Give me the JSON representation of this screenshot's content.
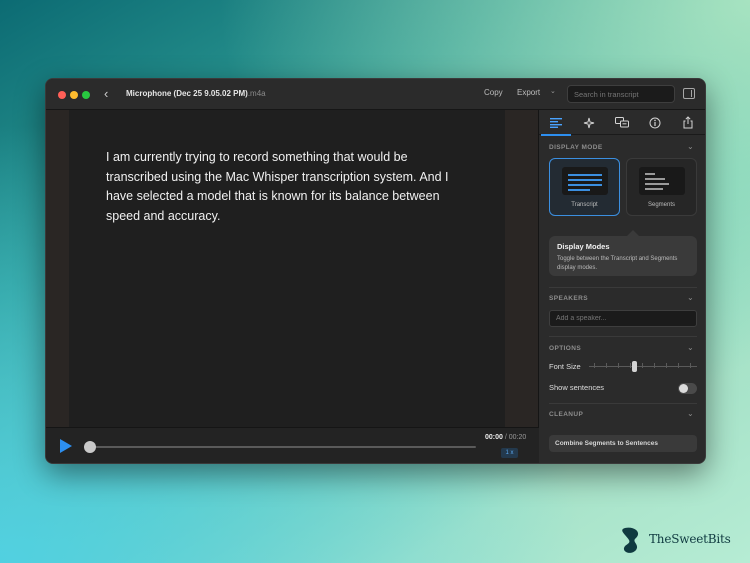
{
  "window": {
    "title": "Microphone (Dec 25 9.05.02 PM)",
    "title_ext": ".m4a",
    "copy_label": "Copy",
    "export_label": "Export",
    "search_placeholder": "Search in transcript"
  },
  "transcript": {
    "text": "I am currently trying to record something that would be transcribed using the Mac Whisper transcription system. And I have selected a model that is known for its balance between speed and accuracy."
  },
  "player": {
    "current_time": "00:00",
    "separator": " / ",
    "total_time": "00:20",
    "speed": "1 x",
    "progress": 0.0
  },
  "panel": {
    "tabs": [
      {
        "name": "display-tab",
        "icon": "list-lines-icon",
        "active": true
      },
      {
        "name": "ai-tab",
        "icon": "sparkle-icon",
        "active": false
      },
      {
        "name": "translate-tab",
        "icon": "translate-icon",
        "active": false
      },
      {
        "name": "info-tab",
        "icon": "info-icon",
        "active": false
      },
      {
        "name": "share-tab",
        "icon": "share-icon",
        "active": false
      }
    ],
    "display_mode": {
      "heading": "DISPLAY MODE",
      "transcript_label": "Transcript",
      "segments_label": "Segments",
      "selected": "Transcript",
      "accent_color": "#3b8fe0"
    },
    "tooltip": {
      "title": "Display Modes",
      "description": "Toggle between the Transcript and Segments display modes."
    },
    "speakers": {
      "heading": "SPEAKERS",
      "placeholder": "Add a speaker..."
    },
    "options": {
      "heading": "OPTIONS",
      "font_size_label": "Font Size",
      "font_size_level": 0.45,
      "show_sentences_label": "Show sentences",
      "show_sentences_on": false
    },
    "cleanup": {
      "heading": "CLEANUP",
      "combine_label": "Combine Segments to Sentences"
    }
  },
  "watermark": {
    "brand": "TheSweetBits"
  }
}
